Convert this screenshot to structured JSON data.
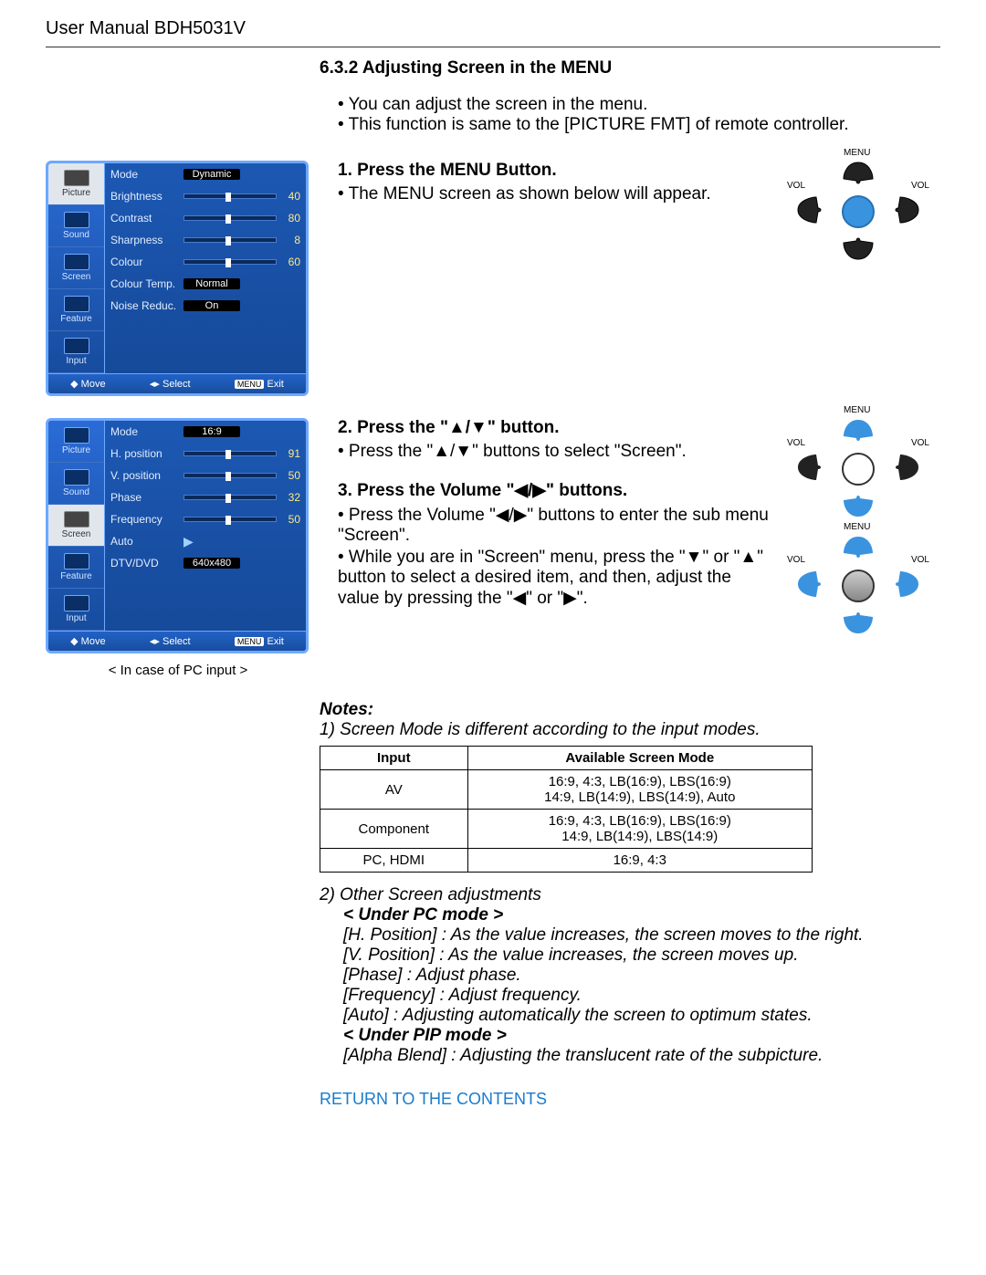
{
  "header_title": "User Manual BDH5031V",
  "section_heading": "6.3.2   Adjusting Screen in the MENU",
  "intro": [
    "You can adjust the screen in the menu.",
    "This function is same to the [PICTURE FMT] of remote controller."
  ],
  "osd1": {
    "tabs": [
      "Picture",
      "Sound",
      "Screen",
      "Feature",
      "Input"
    ],
    "active_tab": "Picture",
    "rows": [
      {
        "label": "Mode",
        "pill": "Dynamic"
      },
      {
        "label": "Brightness",
        "slider": true,
        "value": "40"
      },
      {
        "label": "Contrast",
        "slider": true,
        "value": "80"
      },
      {
        "label": "Sharpness",
        "slider": true,
        "value": "8"
      },
      {
        "label": "Colour",
        "slider": true,
        "value": "60"
      },
      {
        "label": "Colour Temp.",
        "pill": "Normal"
      },
      {
        "label": "Noise Reduc.",
        "pill": "On"
      }
    ],
    "footer": {
      "move": "Move",
      "select": "Select",
      "menu_chip": "MENU",
      "exit": "Exit"
    }
  },
  "osd2": {
    "tabs": [
      "Picture",
      "Sound",
      "Screen",
      "Feature",
      "Input"
    ],
    "active_tab": "Screen",
    "rows": [
      {
        "label": "Mode",
        "pill": "16:9"
      },
      {
        "label": "H. position",
        "slider": true,
        "value": "91"
      },
      {
        "label": "V. position",
        "slider": true,
        "value": "50"
      },
      {
        "label": "Phase",
        "slider": true,
        "value": "32"
      },
      {
        "label": "Frequency",
        "slider": true,
        "value": "50"
      },
      {
        "label": "Auto",
        "arrow": true
      },
      {
        "label": "DTV/DVD",
        "pill": "640x480"
      }
    ],
    "footer": {
      "move": "Move",
      "select": "Select",
      "menu_chip": "MENU",
      "exit": "Exit"
    },
    "caption": "< In case of PC input >"
  },
  "step1": {
    "title": "1. Press the MENU Button.",
    "lines": [
      "• The MENU screen as shown below will appear."
    ]
  },
  "step2": {
    "title": "2. Press the \"▲/▼\" button.",
    "lines": [
      "• Press the \"▲/▼\" buttons to select \"Screen\"."
    ]
  },
  "step3": {
    "title": "3. Press the Volume \"◀/▶\" buttons.",
    "lines": [
      "• Press the Volume \"◀/▶\" buttons to enter the sub menu \"Screen\".",
      "• While you are in \"Screen\" menu, press the \"▼\" or \"▲\" button to select a desired item, and then, adjust the value by pressing the \"◀\" or \"▶\"."
    ]
  },
  "remote_labels": {
    "menu": "MENU",
    "vol": "VOL"
  },
  "notes": {
    "heading": "Notes:",
    "n1": "1) Screen Mode is different according to the input modes.",
    "table": {
      "head": [
        "Input",
        "Available Screen Mode"
      ],
      "rows": [
        [
          "AV",
          "16:9, 4:3, LB(16:9), LBS(16:9)\n14:9, LB(14:9), LBS(14:9), Auto"
        ],
        [
          "Component",
          "16:9, 4:3, LB(16:9), LBS(16:9)\n14:9, LB(14:9), LBS(14:9)"
        ],
        [
          "PC, HDMI",
          "16:9, 4:3"
        ]
      ]
    },
    "n2": "2) Other Screen adjustments",
    "pc_head": "< Under PC mode >",
    "pc_lines": [
      "[H. Position] : As the value increases, the screen moves to the right.",
      "[V. Position] : As the value increases, the screen moves up.",
      "[Phase] : Adjust phase.",
      "[Frequency] : Adjust frequency.",
      "[Auto] : Adjusting automatically the screen to optimum states."
    ],
    "pip_head": "< Under PIP mode >",
    "pip_lines": [
      "[Alpha Blend] : Adjusting the translucent rate of the subpicture."
    ]
  },
  "return_link": "RETURN TO THE CONTENTS"
}
